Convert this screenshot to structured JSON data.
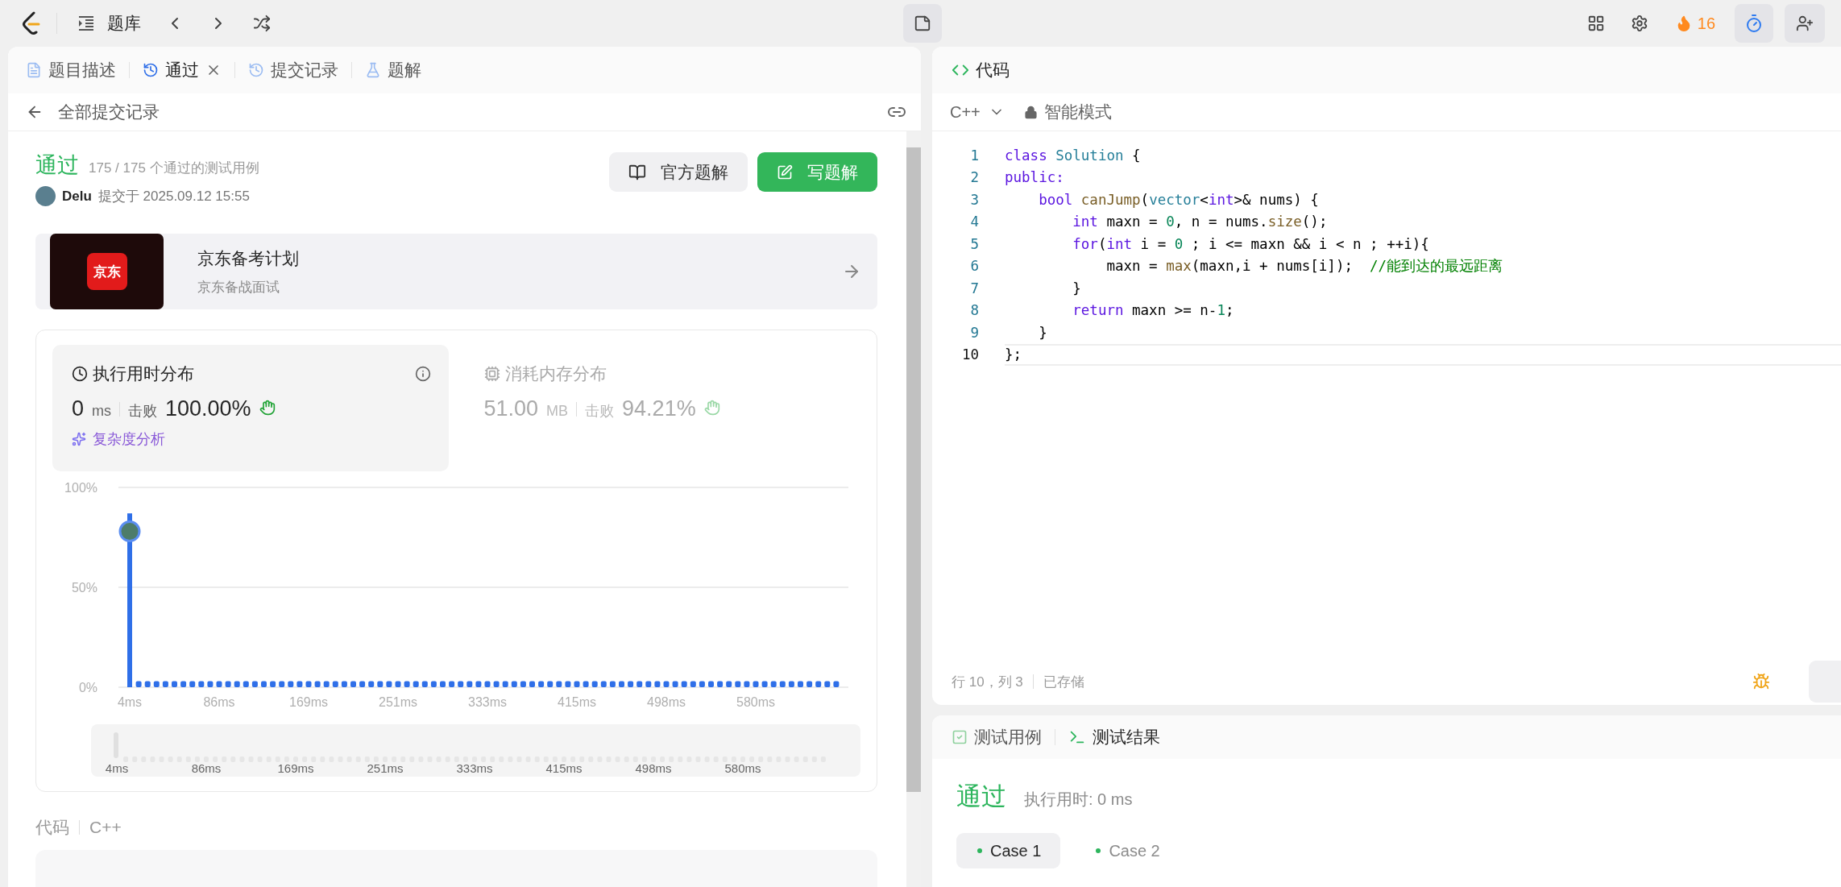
{
  "topbar": {
    "problem_bank": "题库",
    "streak": "16"
  },
  "left_tabs": [
    {
      "label": "题目描述",
      "selected": false,
      "closable": false
    },
    {
      "label": "通过",
      "selected": true,
      "closable": true
    },
    {
      "label": "提交记录",
      "selected": false,
      "closable": false
    },
    {
      "label": "题解",
      "selected": false,
      "closable": false
    }
  ],
  "back_label": "全部提交记录",
  "submission": {
    "status": "通过",
    "tests": "175 / 175 个通过的测试用例",
    "user": "Delu",
    "submitted": "提交于 2025.09.12 15:55",
    "buttons": [
      {
        "label": "官方题解",
        "kind": "secondary"
      },
      {
        "label": "写题解",
        "kind": "primary"
      }
    ]
  },
  "promo": {
    "logo": "京东",
    "title": "京东备考计划",
    "subtitle": "京东备战面试"
  },
  "stats": [
    {
      "title": "执行用时分布",
      "value": "0",
      "unit": "ms",
      "beat_label": "击败",
      "beat": "100.00%",
      "selected": true,
      "link": "复杂度分析"
    },
    {
      "title": "消耗内存分布",
      "value": "51.00",
      "unit": "MB",
      "beat_label": "击败",
      "beat": "94.21%",
      "selected": false
    }
  ],
  "chart_data": {
    "type": "bar",
    "values": [
      87,
      3,
      3,
      3,
      3,
      3,
      3,
      3,
      3,
      3,
      3,
      3,
      3,
      3,
      3,
      3,
      3,
      3,
      3,
      3,
      3,
      3,
      3,
      3,
      3,
      3,
      3,
      3,
      3,
      3,
      3,
      3,
      3,
      3,
      3,
      3,
      3,
      3,
      3,
      3,
      3,
      3,
      3,
      3,
      3,
      3,
      3,
      3,
      3,
      3,
      3,
      3,
      3,
      3,
      3,
      3,
      3,
      3,
      3,
      3,
      3,
      3,
      3,
      3,
      3,
      3,
      3,
      3,
      3,
      3,
      3,
      3,
      3,
      3,
      3,
      3,
      3,
      3,
      3,
      3
    ],
    "ylim": [
      0,
      100
    ],
    "yticks": [
      {
        "value": 0,
        "label": "0%"
      },
      {
        "value": 50,
        "label": "50%"
      },
      {
        "value": 100,
        "label": "100%"
      }
    ],
    "categories": [
      "4ms",
      null,
      null,
      null,
      null,
      null,
      null,
      null,
      null,
      null,
      "86ms",
      null,
      null,
      null,
      null,
      null,
      null,
      null,
      null,
      null,
      "169ms",
      null,
      null,
      null,
      null,
      null,
      null,
      null,
      null,
      null,
      "251ms",
      null,
      null,
      null,
      null,
      null,
      null,
      null,
      null,
      null,
      "333ms",
      null,
      null,
      null,
      null,
      null,
      null,
      null,
      null,
      null,
      "415ms",
      null,
      null,
      null,
      null,
      null,
      null,
      null,
      null,
      null,
      "498ms",
      null,
      null,
      null,
      null,
      null,
      null,
      null,
      null,
      null,
      "580ms",
      null,
      null,
      null,
      null,
      null,
      null,
      null,
      null,
      null
    ]
  },
  "overview": {
    "labels": [
      "4ms",
      "86ms",
      "169ms",
      "251ms",
      "333ms",
      "415ms",
      "498ms",
      "580ms"
    ]
  },
  "code_section": {
    "label": "代码",
    "language": "C++"
  },
  "editor": {
    "title": "代码",
    "language": "C++",
    "mode": "智能模式",
    "lines": [
      {
        "number": "1",
        "current": false,
        "tokens": [
          {
            "kind": "keyword",
            "text": "class "
          },
          {
            "kind": "type",
            "text": "Solution"
          },
          {
            "kind": "plain",
            "text": " {"
          }
        ]
      },
      {
        "number": "2",
        "current": false,
        "tokens": [
          {
            "kind": "keyword",
            "text": "public:"
          }
        ]
      },
      {
        "number": "3",
        "current": false,
        "tokens": [
          {
            "kind": "keyword",
            "text": "    bool "
          },
          {
            "kind": "function",
            "text": "canJump"
          },
          {
            "kind": "plain",
            "text": "("
          },
          {
            "kind": "type",
            "text": "vector"
          },
          {
            "kind": "plain",
            "text": "<"
          },
          {
            "kind": "keyword",
            "text": "int"
          },
          {
            "kind": "plain",
            "text": ">& nums) {"
          }
        ]
      },
      {
        "number": "4",
        "current": false,
        "tokens": [
          {
            "kind": "keyword",
            "text": "        int"
          },
          {
            "kind": "plain",
            "text": " maxn = "
          },
          {
            "kind": "number",
            "text": "0"
          },
          {
            "kind": "plain",
            "text": ", n = nums."
          },
          {
            "kind": "function",
            "text": "size"
          },
          {
            "kind": "plain",
            "text": "();"
          }
        ]
      },
      {
        "number": "5",
        "current": false,
        "tokens": [
          {
            "kind": "keyword",
            "text": "        for"
          },
          {
            "kind": "plain",
            "text": "("
          },
          {
            "kind": "keyword",
            "text": "int"
          },
          {
            "kind": "plain",
            "text": " i = "
          },
          {
            "kind": "number",
            "text": "0"
          },
          {
            "kind": "plain",
            "text": " ; i <= maxn && i < n ; ++i){"
          }
        ]
      },
      {
        "number": "6",
        "current": false,
        "tokens": [
          {
            "kind": "plain",
            "text": "            maxn = "
          },
          {
            "kind": "function",
            "text": "max"
          },
          {
            "kind": "plain",
            "text": "(maxn,i + nums[i]);  "
          },
          {
            "kind": "comment",
            "text": "//能到达的最远距离"
          }
        ]
      },
      {
        "number": "7",
        "current": false,
        "tokens": [
          {
            "kind": "plain",
            "text": "        }"
          }
        ]
      },
      {
        "number": "8",
        "current": false,
        "tokens": [
          {
            "kind": "keyword",
            "text": "        return"
          },
          {
            "kind": "plain",
            "text": " maxn >= n-"
          },
          {
            "kind": "number",
            "text": "1"
          },
          {
            "kind": "plain",
            "text": ";"
          }
        ]
      },
      {
        "number": "9",
        "current": false,
        "tokens": [
          {
            "kind": "plain",
            "text": "    }"
          }
        ]
      },
      {
        "number": "10",
        "current": true,
        "tokens": [
          {
            "kind": "plain",
            "text": "};"
          }
        ]
      }
    ],
    "status": {
      "position": "行 10，列 3",
      "saved": "已存储"
    }
  },
  "console": {
    "tabs": [
      {
        "label": "测试用例",
        "selected": false
      },
      {
        "label": "测试结果",
        "selected": true
      }
    ],
    "status": "通过",
    "runtime": "执行用时: 0 ms",
    "cases": [
      {
        "label": "Case 1",
        "selected": true
      },
      {
        "label": "Case 2",
        "selected": false
      }
    ]
  }
}
